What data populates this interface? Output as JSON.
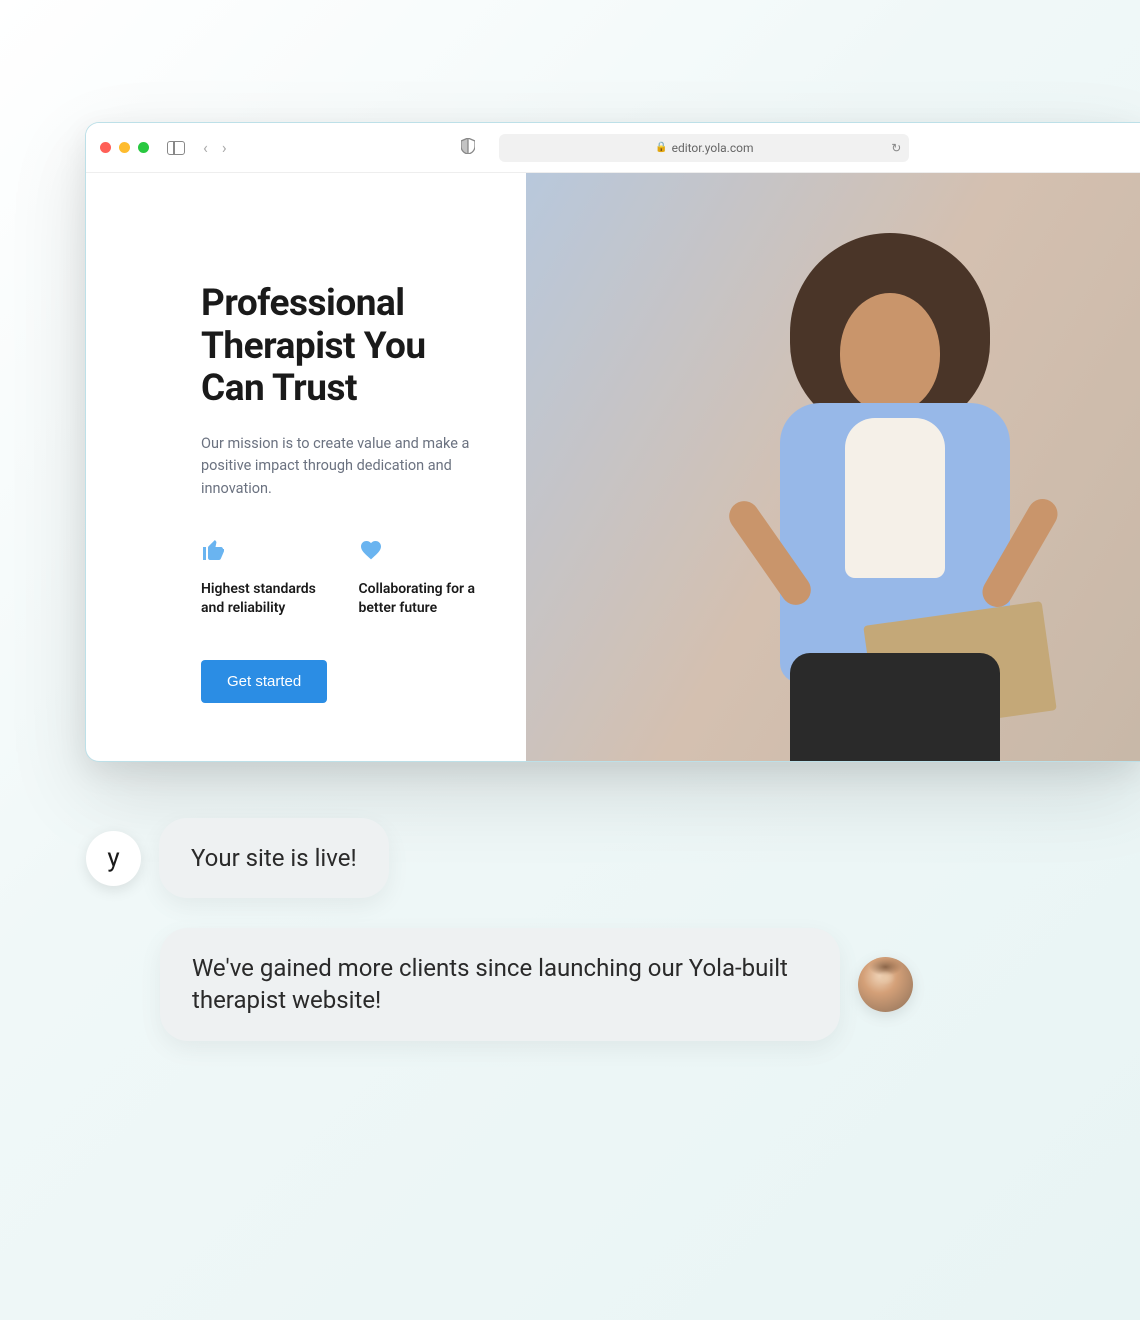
{
  "browser": {
    "url": "editor.yola.com"
  },
  "hero": {
    "title": "Professional Therapist You Can Trust",
    "subtitle": "Our mission is to create value and make a positive impact through dedication and innovation.",
    "features": [
      {
        "icon": "thumbs-up",
        "text": "Highest standards and reliability"
      },
      {
        "icon": "heart",
        "text": "Collaborating for a better future"
      }
    ],
    "cta": "Get started"
  },
  "chat": {
    "brand_glyph": "y",
    "messages": [
      "Your site is live!",
      "We've gained more clients since launching our Yola-built therapist website!"
    ]
  }
}
